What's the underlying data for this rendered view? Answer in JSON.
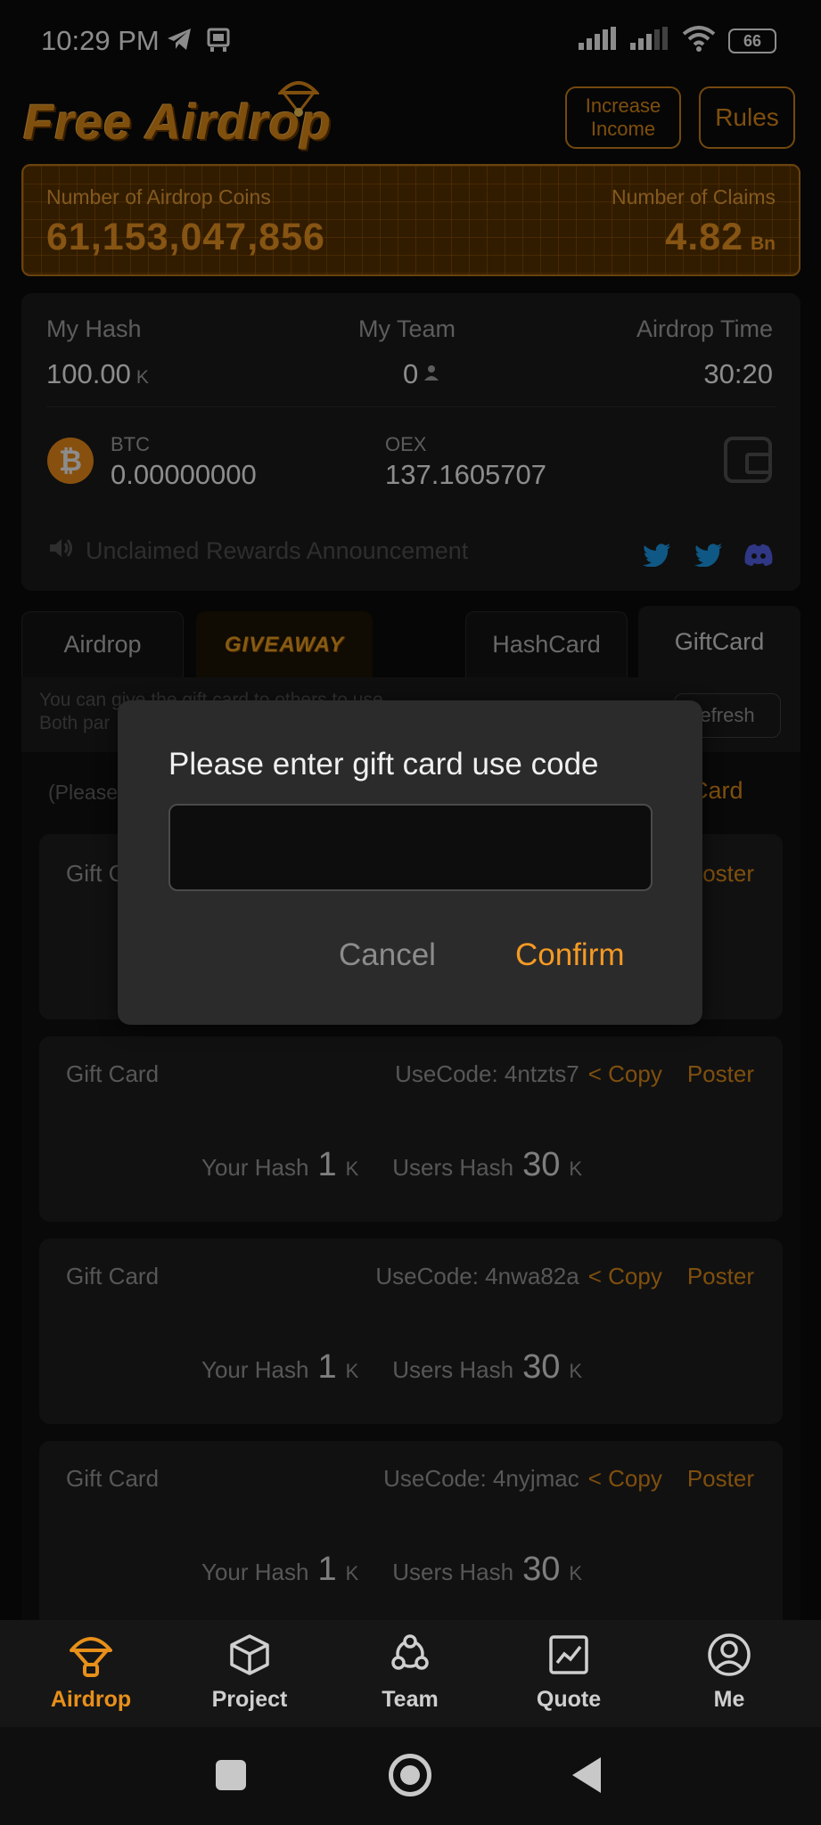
{
  "status_bar": {
    "time": "10:29 PM",
    "battery": "66"
  },
  "header": {
    "logo": "Free Airdrop",
    "increase_income": "Increase Income",
    "rules": "Rules"
  },
  "stats": {
    "coins_label": "Number of Airdrop Coins",
    "coins_value": "61,153,047,856",
    "claims_label": "Number of Claims",
    "claims_value": "4.82",
    "claims_unit": "Bn"
  },
  "hash_card": {
    "my_hash_label": "My Hash",
    "my_hash_value": "100.00",
    "my_hash_unit": "K",
    "my_team_label": "My Team",
    "my_team_value": "0",
    "airdrop_time_label": "Airdrop Time",
    "airdrop_time_value": "30:20",
    "btc_label": "BTC",
    "btc_value": "0.00000000",
    "oex_label": "OEX",
    "oex_value": "137.1605707",
    "announcement": "Unclaimed Rewards Announcement"
  },
  "tabs": {
    "airdrop": "Airdrop",
    "giveaway": "GIVEAWAY",
    "hashcard": "HashCard",
    "giftcard": "GiftCard"
  },
  "panel": {
    "info_line1": "You can give the gift card to others to use",
    "info_line2": "Both par",
    "refresh": "efresh",
    "hint": "(Please",
    "gift_card_link": "t Card"
  },
  "gift_cards": [
    {
      "title": "Gift C",
      "poster": "oster"
    },
    {
      "title": "Gift Card",
      "code": "UseCode: 4ntzts7",
      "copy": "< Copy",
      "poster": "Poster",
      "your_hash_label": "Your Hash",
      "your_hash_value": "1",
      "your_hash_unit": "K",
      "users_hash_label": "Users Hash",
      "users_hash_value": "30",
      "users_hash_unit": "K"
    },
    {
      "title": "Gift Card",
      "code": "UseCode: 4nwa82a",
      "copy": "< Copy",
      "poster": "Poster",
      "your_hash_label": "Your Hash",
      "your_hash_value": "1",
      "your_hash_unit": "K",
      "users_hash_label": "Users Hash",
      "users_hash_value": "30",
      "users_hash_unit": "K"
    },
    {
      "title": "Gift Card",
      "code": "UseCode: 4nyjmac",
      "copy": "< Copy",
      "poster": "Poster",
      "your_hash_label": "Your Hash",
      "your_hash_value": "1",
      "your_hash_unit": "K",
      "users_hash_label": "Users Hash",
      "users_hash_value": "30",
      "users_hash_unit": "K"
    }
  ],
  "dialog": {
    "title": "Please enter gift card use code",
    "input_value": "",
    "cancel": "Cancel",
    "confirm": "Confirm"
  },
  "bottom_nav": {
    "airdrop": "Airdrop",
    "project": "Project",
    "team": "Team",
    "quote": "Quote",
    "me": "Me"
  },
  "colors": {
    "accent": "#e8901a",
    "background": "#0b0b0b",
    "card": "#1f1f1f",
    "bitcoin": "#f7931a",
    "twitter": "#1da1f2",
    "discord": "#5865f2"
  },
  "icons": {
    "status": [
      "telegram-icon",
      "sim-icon",
      "signal-icon",
      "wifi-icon",
      "battery-icon"
    ],
    "social": [
      "twitter-icon",
      "discord-icon"
    ],
    "nav": [
      "parachute-icon",
      "cube-icon",
      "team-icon",
      "chart-icon",
      "user-icon"
    ]
  }
}
